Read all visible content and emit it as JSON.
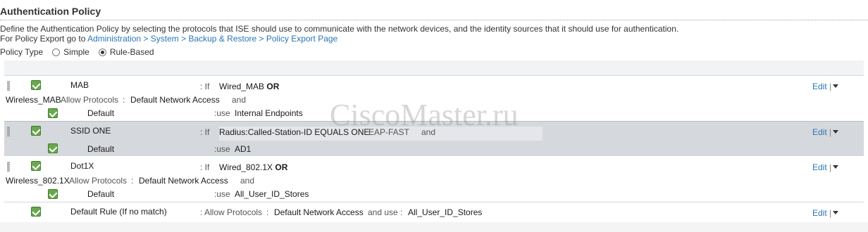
{
  "header": {
    "title": "Authentication Policy",
    "description": "Define the Authentication Policy by selecting the protocols that ISE should use to communicate with the network devices, and the identity sources that it should use for authentication.",
    "export_prefix": "For Policy Export go to ",
    "export_link": "Administration > System > Backup & Restore > Policy Export Page"
  },
  "policy_type": {
    "label": "Policy Type",
    "options": [
      {
        "label": "Simple",
        "selected": false
      },
      {
        "label": "Rule-Based",
        "selected": true
      }
    ]
  },
  "rules": [
    {
      "name": "MAB",
      "if_label": ": If",
      "condition": "Wired_MAB",
      "operator": "OR",
      "condition_cont": "Wireless_MAB",
      "allow_label": "Allow Protocols",
      "colon": ":",
      "protocols": "Default Network Access",
      "and_label": "and",
      "sub_name": "Default",
      "use_label": ":use",
      "identity": "Internal Endpoints",
      "edit": "Edit",
      "pipe": "|"
    },
    {
      "name": "SSID ONE",
      "if_label": ": If",
      "condition": "Radius:Called-Station-ID EQUALS ONE",
      "protocols": "EAP-FAST",
      "and_label": "and",
      "sub_name": "Default",
      "use_label": ":use",
      "identity": "AD1",
      "edit": "Edit",
      "pipe": "|"
    },
    {
      "name": "Dot1X",
      "if_label": ": If",
      "condition": "Wired_802.1X",
      "operator": "OR",
      "condition_cont": "Wireless_802.1X",
      "allow_label": "Allow Protocols",
      "colon": ":",
      "protocols": "Default Network Access",
      "and_label": "and",
      "sub_name": "Default",
      "use_label": ":use",
      "identity": "All_User_ID_Stores",
      "edit": "Edit",
      "pipe": "|"
    },
    {
      "name": "Default Rule (If no match)",
      "allow_label": ": Allow Protocols",
      "colon": ":",
      "protocols": "Default Network Access",
      "and_use_label": "and use :",
      "identity": "All_User_ID_Stores",
      "edit": "Edit",
      "pipe": "|"
    }
  ],
  "watermark": "CiscoMaster.ru",
  "colors": {
    "link": "#2a76b8",
    "check_green": "#6aa84f",
    "selected_row": "#d5d8dc"
  }
}
